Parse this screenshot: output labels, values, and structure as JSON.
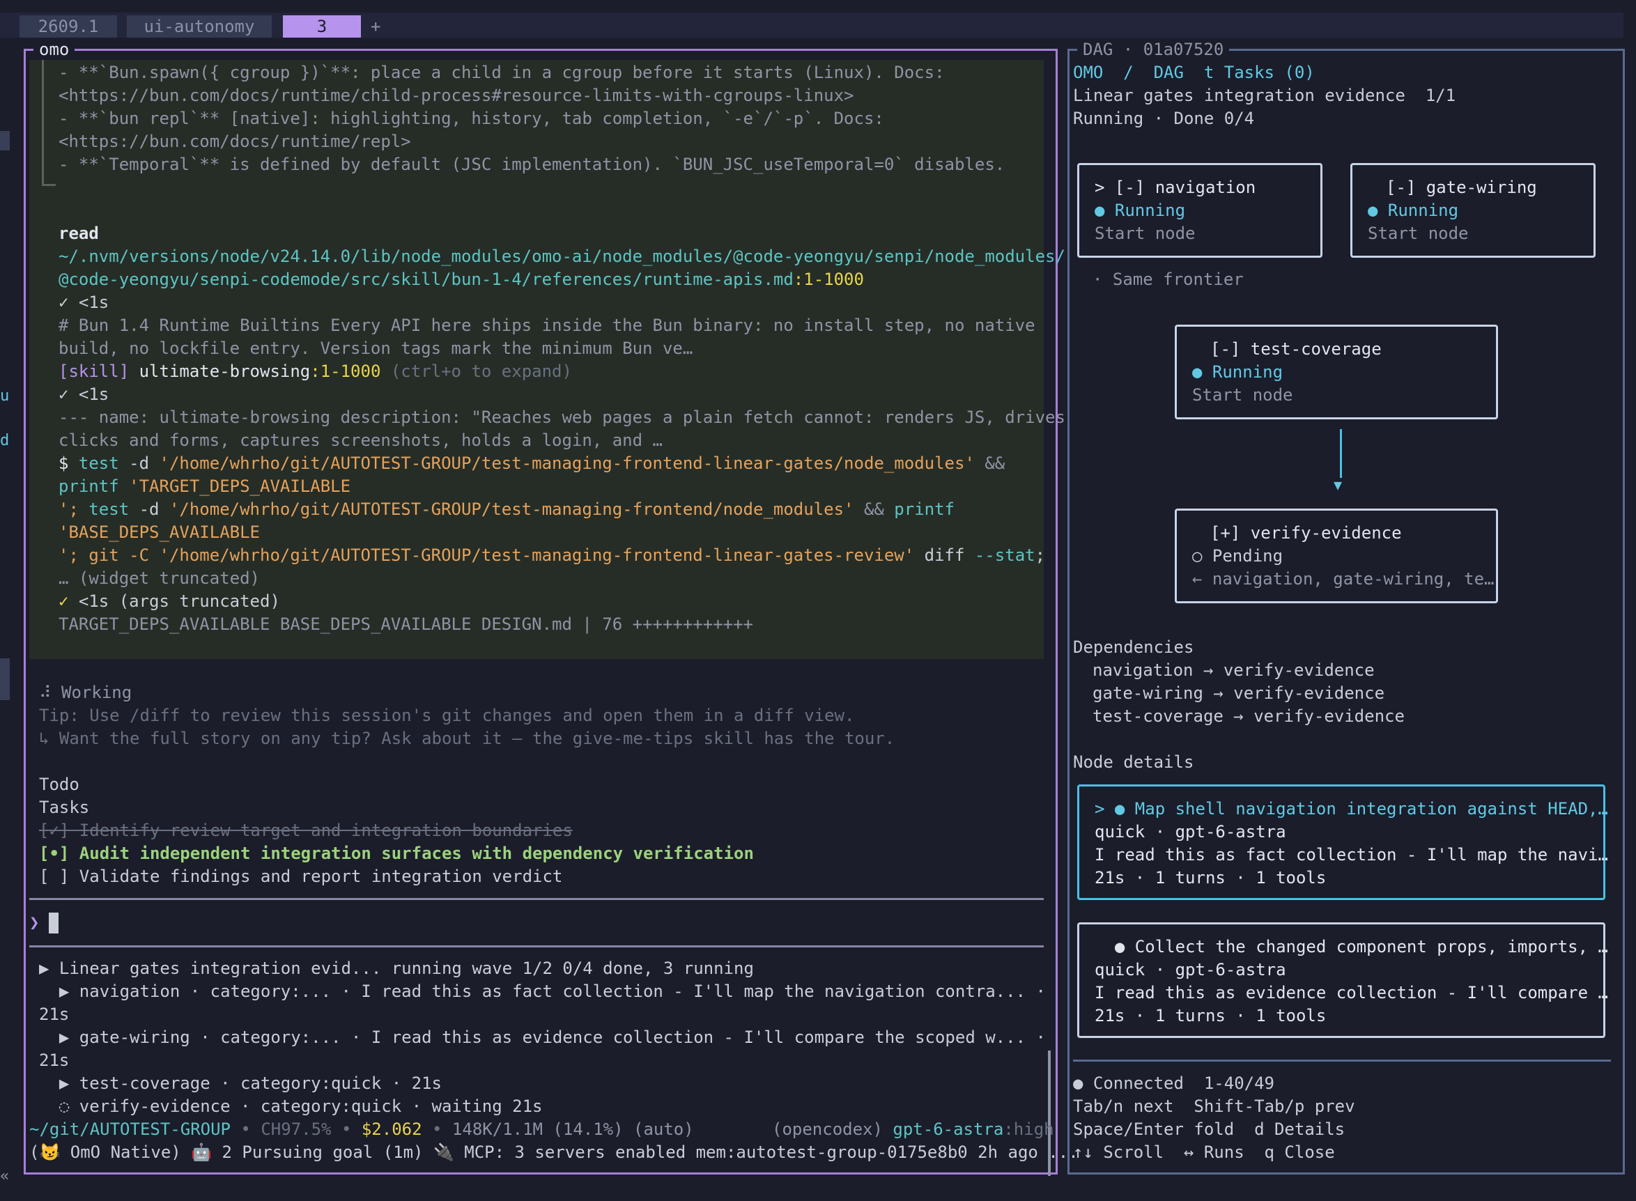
{
  "tabs": [
    {
      "label": "2609.1"
    },
    {
      "label": "ui-autonomy"
    },
    {
      "label": "3"
    }
  ],
  "tab_new_label": "+",
  "left_margin_glyphs": [
    "u",
    "d",
    "«"
  ],
  "left_pane": {
    "title": "omo",
    "output": {
      "bun_lines": [
        "- **`Bun.spawn({ cgroup })`**: place a child in a cgroup before it starts (Linux). Docs:",
        "<https://bun.com/docs/runtime/child-process#resource-limits-with-cgroups-linux>",
        "- **`bun repl`** [native]: highlighting, history, tab completion, `-e`/`-p`. Docs:",
        "<https://bun.com/docs/runtime/repl>",
        "- **`Temporal`** is defined by default (JSC implementation). `BUN_JSC_useTemporal=0` disables."
      ],
      "read_label": "read",
      "read_path_1": "~/.nvm/versions/node/v24.14.0/lib/node_modules/omo-ai/node_modules/@code-yeongyu/senpi/node_modules/",
      "read_path_2": "@code-yeongyu/senpi-codemode/src/skill/bun-1-4/references/runtime-apis.md",
      "read_range": ":1-1000",
      "check_1": "✓ <1s",
      "bun_summary_1": "# Bun 1.4 Runtime Builtins Every API here ships inside the Bun binary: no install step, no native",
      "bun_summary_2": "build, no lockfile entry. Version tags mark the minimum Bun ve…",
      "skill_tag": "[skill]",
      "skill_name": " ultimate-browsing",
      "skill_range": ":1-1000",
      "skill_hint": " (ctrl+o to expand)",
      "check_2": "✓ <1s",
      "skill_desc_1": "--- name: ultimate-browsing description: \"Reaches web pages a plain fetch cannot: renders JS, drives",
      "skill_desc_2": "clicks and forms, captures screenshots, holds a login, and …",
      "cmd": {
        "prompt": "$",
        "l1_kw": " test",
        "l1_flag": " -d ",
        "l1_str": "'/home/whrho/git/AUTOTEST-GROUP/test-managing-frontend-linear-gates/node_modules'",
        "l1_op": " &&",
        "l2_kw": "printf",
        "l2_str": " 'TARGET_DEPS_AVAILABLE",
        "l3_a": "';",
        "l3_kw": " test",
        "l3_flag": " -d ",
        "l3_str": "'/home/whrho/git/AUTOTEST-GROUP/test-managing-frontend/node_modules'",
        "l3_op": " &&",
        "l3_kw2": " printf",
        "l4_str": "'BASE_DEPS_AVAILABLE",
        "l5_a": "'; git -C ",
        "l5_str": "'/home/whrho/git/AUTOTEST-GROUP/test-managing-frontend-linear-gates-review'",
        "l5_b": " diff ",
        "l5_flag": "--stat",
        "l5_c": ";"
      },
      "truncated_note": "… (widget truncated)",
      "check_3_mark": "✓",
      "check_3_text": " <1s (args truncated)",
      "result_line": "TARGET_DEPS_AVAILABLE BASE_DEPS_AVAILABLE DESIGN.md | 76 ++++++++++++"
    },
    "working": {
      "spinner": "⠼",
      "label": " Working",
      "tip": "Tip: Use /diff to review this session's git changes and open them in a diff view.",
      "tip_more": "↳ Want the full story on any tip? Ask about it — the give-me-tips skill has the tour."
    },
    "todo": {
      "heading": "Todo",
      "tasks_label": "Tasks",
      "items": [
        {
          "text": "[✓] Identify review target and integration boundaries",
          "state": "done"
        },
        {
          "text": "[•] Audit independent integration surfaces with dependency verification",
          "state": "active"
        },
        {
          "text": "[ ] Validate findings and report integration verdict",
          "state": "pending"
        }
      ]
    },
    "input_prompt": "❯",
    "run_tree": {
      "root": "▶ Linear gates integration evid... running wave 1/2 0/4 done, 3 running",
      "items": [
        {
          "line": "  ▶ navigation · category:... · I read this as fact collection - I'll map the navigation contra... ·",
          "time": "21s"
        },
        {
          "line": "  ▶ gate-wiring · category:... · I read this as evidence collection - I'll compare the scoped w... ·",
          "time": "21s"
        },
        {
          "line": "  ▶ test-coverage · category:quick · 21s",
          "time": ""
        },
        {
          "line": "  ◌ verify-evidence · category:quick · waiting 21s",
          "time": ""
        }
      ]
    },
    "status_bar": {
      "cwd": "~/git/AUTOTEST-GROUP",
      "sep": " • ",
      "ctx": "CH97.5%",
      "cost": "$2.062",
      "tokens": "148K/1.1M (14.1%) (auto)",
      "provider": "(opencodex)",
      "model": " gpt-6-astra",
      "effort": ":high",
      "line2": "(😼 OmO Native) 🤖 2 Pursuing goal (1m) 🔌 MCP: 3 servers enabled mem:autotest-group-0175e8b0 2h ago ..."
    }
  },
  "right_pane": {
    "title": "DAG · 01a07520",
    "crumb": "OMO  /  DAG  t Tasks (0)",
    "plan_title": "Linear gates integration evidence  1/1",
    "plan_status": "Running · Done 0/4",
    "nodes": [
      {
        "title": "> [-] navigation",
        "status": "Running",
        "note": "Start node",
        "state": "running"
      },
      {
        "title": "[-] gate-wiring",
        "status": "Running",
        "note": "Start node",
        "state": "running"
      },
      {
        "title": "[-] test-coverage",
        "status": "Running",
        "note": "Start node",
        "state": "running"
      },
      {
        "title": "[+] verify-evidence",
        "status": "Pending",
        "note": "← navigation, gate-wiring, te…",
        "state": "pending"
      }
    ],
    "frontier_label": "· Same frontier",
    "arrow_head": "▼",
    "dependencies": {
      "heading": "Dependencies",
      "items": [
        "navigation → verify-evidence",
        "gate-wiring → verify-evidence",
        "test-coverage → verify-evidence"
      ]
    },
    "node_details": {
      "heading": "Node details",
      "cards": [
        {
          "title": "> ● Map shell navigation integration against HEAD,…",
          "model": "quick · gpt-6-astra",
          "desc": "I read this as fact collection - I'll map the navi…",
          "stats": "21s · 1 turns · 1 tools"
        },
        {
          "title": "  ● Collect the changed component props, imports, …",
          "model": "quick · gpt-6-astra",
          "desc": "I read this as evidence collection - I'll compare …",
          "stats": "21s · 1 turns · 1 tools"
        }
      ]
    },
    "footer": {
      "connected": "● Connected  1-40/49",
      "keys_1": "Tab/n next  Shift-Tab/p prev",
      "keys_2": "Space/Enter fold  d Details",
      "keys_3": "↑↓ Scroll  ↔ Runs  q Close"
    }
  },
  "colors": {
    "accent_purple": "#b693ec",
    "running_cyan": "#49c1e6",
    "string_orange": "#e5a25c",
    "range_yellow": "#e8d44d"
  }
}
